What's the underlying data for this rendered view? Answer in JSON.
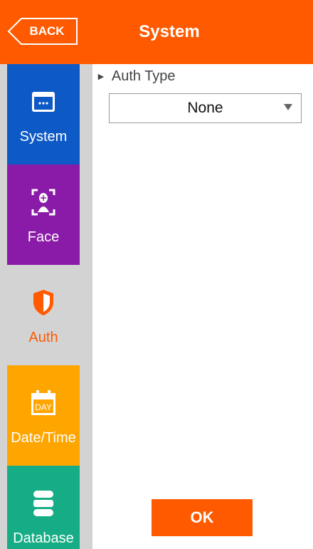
{
  "header": {
    "back_label": "BACK",
    "title": "System"
  },
  "sidebar": {
    "items": [
      {
        "label": "System",
        "icon": "calendar-dots-icon",
        "color": "#0d5ac6"
      },
      {
        "label": "Face",
        "icon": "face-scan-icon",
        "color": "#8a1aa8"
      },
      {
        "label": "Auth",
        "icon": "shield-icon",
        "color": "#d3d3d3",
        "selected": true
      },
      {
        "label": "Date/Time",
        "icon": "calendar-day-icon",
        "color": "#ffa500",
        "icon_text": "DAY"
      },
      {
        "label": "Database",
        "icon": "database-icon",
        "color": "#16ad86"
      }
    ]
  },
  "main": {
    "section_label": "Auth Type",
    "auth_type_value": "None",
    "ok_label": "OK"
  },
  "colors": {
    "accent": "#ff5a00",
    "selected_text": "#ff5a00",
    "sidebar_bg": "#d3d3d3"
  }
}
